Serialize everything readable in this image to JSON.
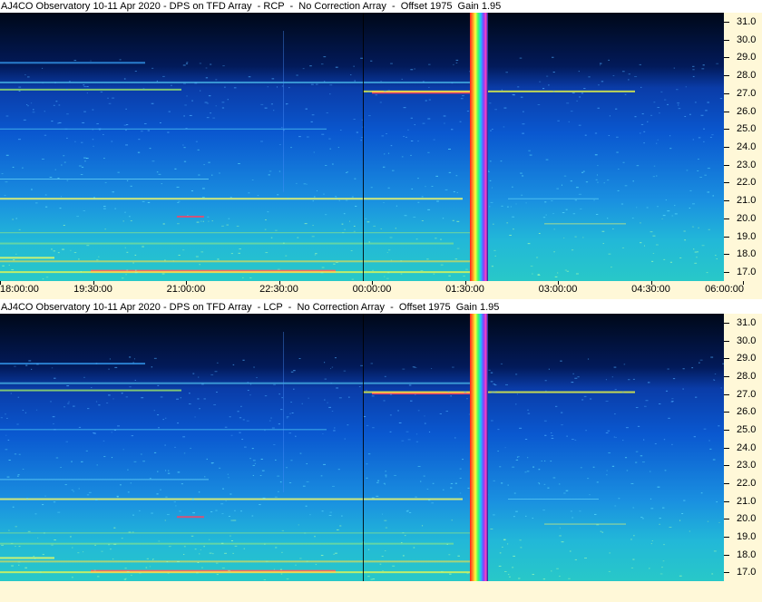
{
  "colors": {
    "axis_bg": "#fff8d8",
    "background_top": "#000820",
    "background_mid": "#0a48c8",
    "background_low": "#1aa8d8"
  },
  "chart_data": [
    {
      "type": "heatmap",
      "title": "AJ4CO Observatory 10-11 Apr 2020 - DPS on TFD Array  - RCP  -  No Correction Array  -  Offset 1975  Gain 1.95",
      "x_tick_labels": [
        "18:00:00",
        "19:30:00",
        "21:00:00",
        "22:30:00",
        "00:00:00",
        "01:30:00",
        "03:00:00",
        "04:30:00",
        "06:00:00"
      ],
      "y_tick_labels": [
        "31.0",
        "30.0",
        "29.0",
        "28.0",
        "27.0",
        "26.0",
        "25.0",
        "24.0",
        "23.0",
        "22.0",
        "21.0",
        "20.0",
        "19.0",
        "18.0",
        "17.0"
      ],
      "ylim": [
        16.5,
        31.5
      ],
      "colormap": "spectral-rainbow",
      "grid": false
    },
    {
      "type": "heatmap",
      "title": "AJ4CO Observatory 10-11 Apr 2020 - DPS on TFD Array  - LCP  -  No Correction Array  -  Offset 1975  Gain 1.95",
      "x_tick_labels": [],
      "y_tick_labels": [
        "31.0",
        "30.0",
        "29.0",
        "28.0",
        "27.0",
        "26.0",
        "25.0",
        "24.0",
        "23.0",
        "22.0",
        "21.0",
        "20.0",
        "19.0",
        "18.0",
        "17.0"
      ],
      "ylim": [
        16.5,
        31.5
      ],
      "colormap": "spectral-rainbow",
      "grid": false
    }
  ]
}
